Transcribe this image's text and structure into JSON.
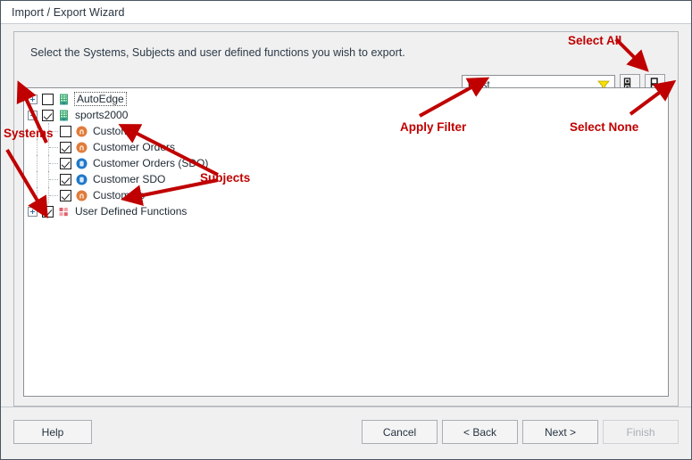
{
  "window": {
    "title": "Import / Export Wizard"
  },
  "page": {
    "instruction": "Select the Systems, Subjects and user defined functions you wish to export."
  },
  "filter": {
    "value": "Cust",
    "placeholder": "",
    "funnel_icon": "funnel-icon",
    "select_all_button": {
      "icon": "select-all-icon",
      "tooltip": "Select All"
    },
    "select_none_button": {
      "icon": "select-none-icon",
      "tooltip": "Select None"
    }
  },
  "tree": {
    "nodes": [
      {
        "label": "AutoEdge",
        "level": 0,
        "expander": "plus",
        "checked": false,
        "icon": "system-building-icon",
        "icon_type": "system",
        "focused": true
      },
      {
        "label": "sports2000",
        "level": 0,
        "expander": "minus",
        "checked": true,
        "icon": "system-building-icon",
        "icon_type": "system",
        "focused": false
      },
      {
        "label": "Customer",
        "level": 1,
        "expander": "none",
        "checked": false,
        "icon": "subject-orange-icon",
        "icon_type": "subject-orange",
        "focused": false
      },
      {
        "label": "Customer Orders",
        "level": 1,
        "expander": "none",
        "checked": true,
        "icon": "subject-orange-icon",
        "icon_type": "subject-orange",
        "focused": false
      },
      {
        "label": "Customer Orders (SDO)",
        "level": 1,
        "expander": "none",
        "checked": true,
        "icon": "subject-blue-icon",
        "icon_type": "subject-blue",
        "focused": false
      },
      {
        "label": "Customer SDO",
        "level": 1,
        "expander": "none",
        "checked": true,
        "icon": "subject-blue-icon",
        "icon_type": "subject-blue",
        "focused": false
      },
      {
        "label": "Customers",
        "level": 1,
        "expander": "none",
        "checked": true,
        "icon": "subject-orange-icon",
        "icon_type": "subject-orange",
        "focused": false
      },
      {
        "label": "User Defined Functions",
        "level": 0,
        "expander": "plus",
        "checked": true,
        "icon": "udf-grid-icon",
        "icon_type": "udf",
        "focused": false
      }
    ]
  },
  "buttons": {
    "help": "Help",
    "cancel": "Cancel",
    "back": "< Back",
    "next": "Next >",
    "finish": "Finish"
  },
  "annotations": {
    "select_all": "Select All",
    "select_none": "Select None",
    "apply_filter": "Apply Filter",
    "systems": "Systems",
    "subjects": "Subjects",
    "color": "#c00000"
  },
  "colors": {
    "accent_red": "#c00000",
    "system_icon": "#2f9e6e",
    "subject_orange": "#e07b39",
    "subject_blue": "#1f78c8",
    "udf_red": "#e0606a",
    "funnel_yellow": "#f5e000",
    "title_text": "#283440"
  }
}
